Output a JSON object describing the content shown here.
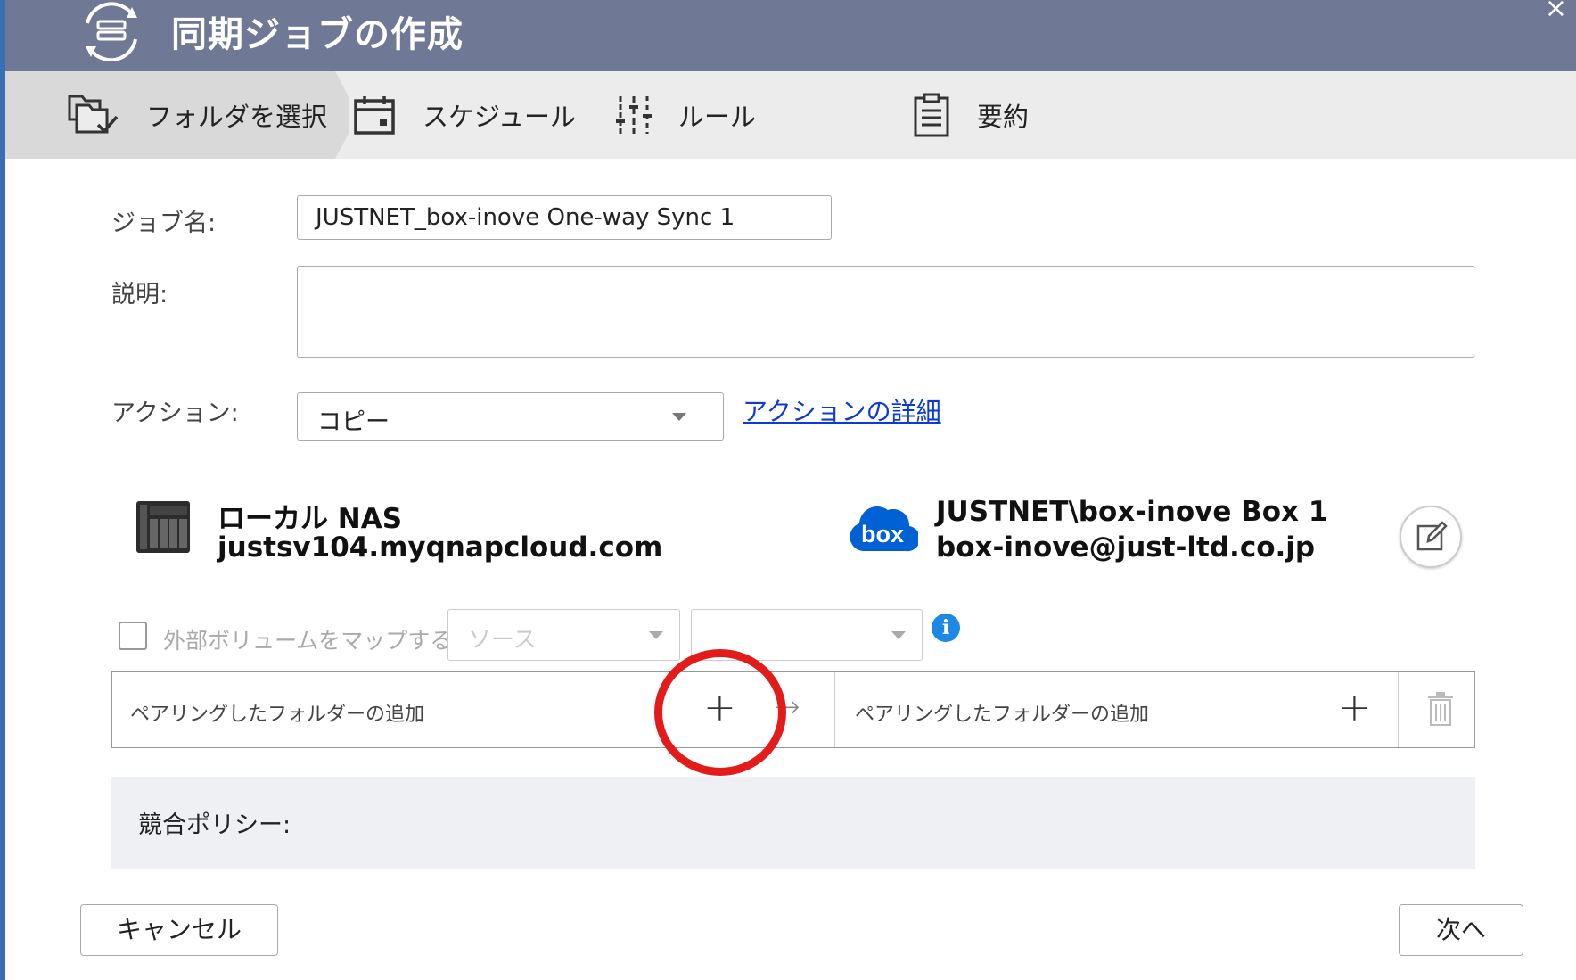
{
  "window": {
    "title": "同期ジョブの作成",
    "close_glyph": "×"
  },
  "wizard": {
    "steps": [
      {
        "label": "フォルダを選択",
        "icon": "folders-check-icon",
        "active": true
      },
      {
        "label": "スケジュール",
        "icon": "calendar-icon",
        "active": false
      },
      {
        "label": "ルール",
        "icon": "sliders-icon",
        "active": false
      },
      {
        "label": "要約",
        "icon": "clipboard-icon",
        "active": false
      }
    ]
  },
  "form": {
    "job_name_label": "ジョブ名:",
    "job_name_value": "JUSTNET_box-inove One-way Sync 1",
    "description_label": "説明:",
    "description_value": "",
    "action_label": "アクション:",
    "action_value": "コピー",
    "action_details_link": "アクションの詳細"
  },
  "local": {
    "name": "ローカル NAS",
    "host": "justsv104.myqnapcloud.com",
    "icon": "nas-device-icon"
  },
  "remote": {
    "name": "JUSTNET\\box-inove Box 1",
    "account": "box-inove@just-ltd.co.jp",
    "icon": "box-cloud-icon",
    "brand_text": "box",
    "brand_color": "#0061d5"
  },
  "map_volume": {
    "checkbox_label": "外部ボリュームをマップする",
    "source_placeholder": "ソース",
    "target_placeholder": ""
  },
  "pairing": {
    "left_label": "ペアリングしたフォルダーの追加",
    "right_label": "ペアリングしたフォルダーの追加",
    "plus_glyph": "+",
    "arrow_glyph": "→"
  },
  "policy": {
    "label": "競合ポリシー:"
  },
  "footer": {
    "cancel_label": "キャンセル",
    "next_label": "次へ"
  },
  "colors": {
    "title_bar": "#6f7894",
    "highlight_circle": "#e41b1b",
    "link": "#0b3ad8",
    "info": "#1e88e5"
  }
}
